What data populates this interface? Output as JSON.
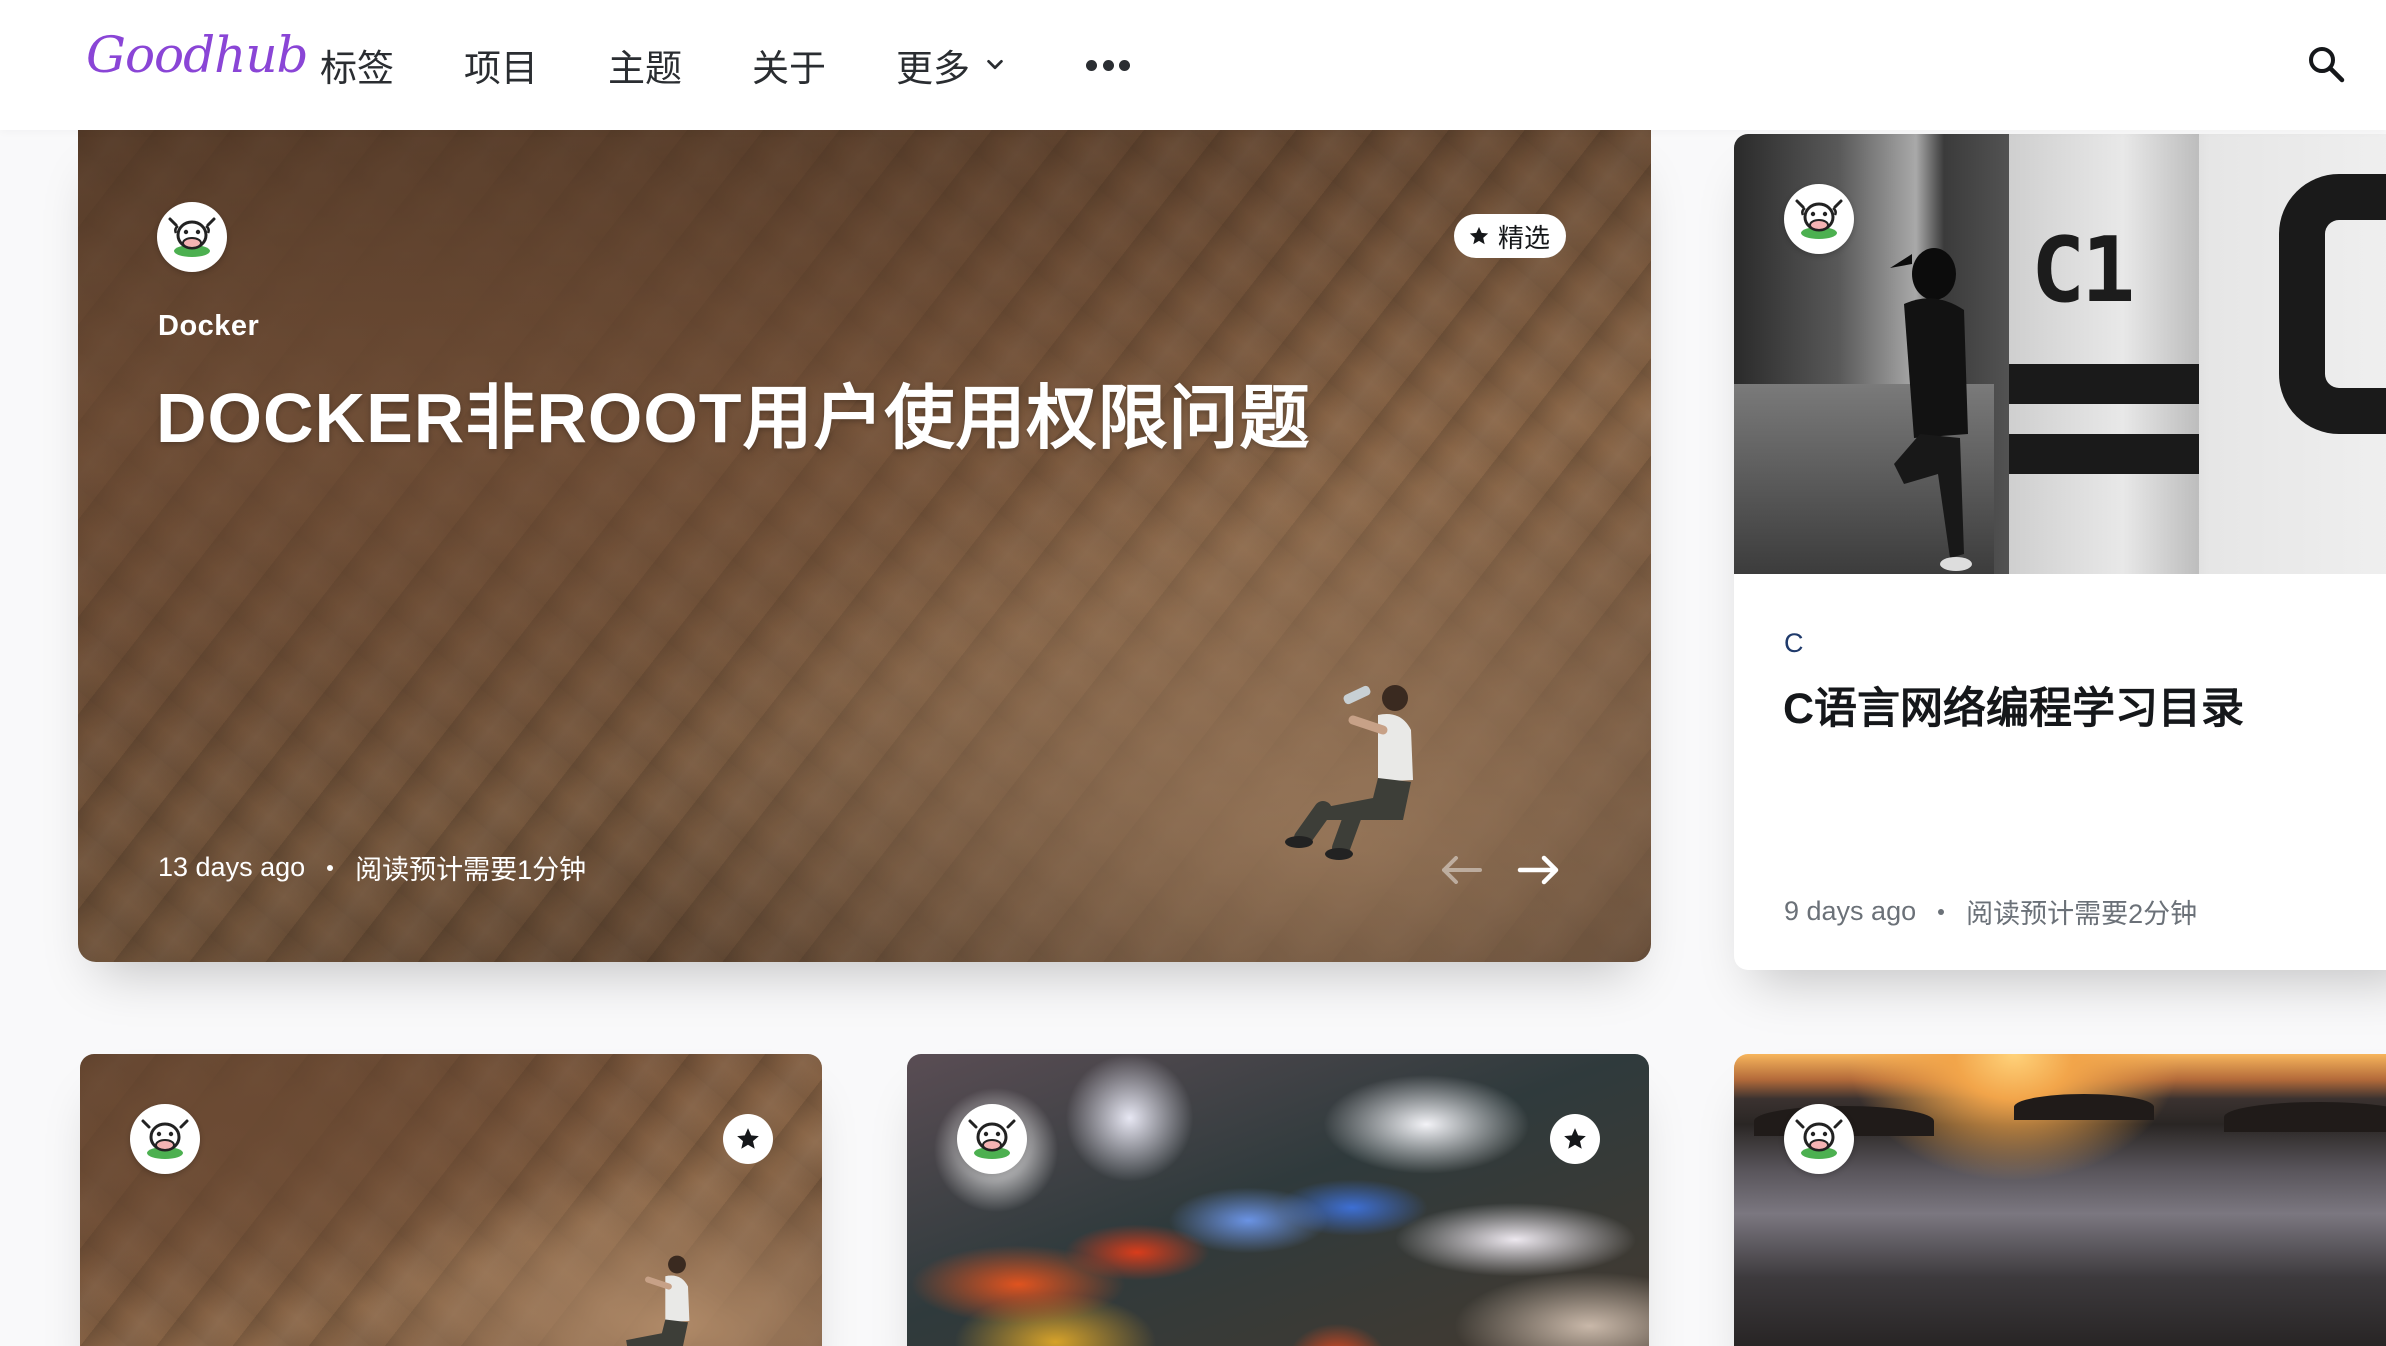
{
  "header": {
    "logo": "Goodhub",
    "nav": [
      {
        "label": "标签"
      },
      {
        "label": "项目"
      },
      {
        "label": "主题"
      },
      {
        "label": "关于"
      },
      {
        "label": "更多"
      }
    ]
  },
  "featured": {
    "tag": "Docker",
    "title": "DOCKER非ROOT用户使用权限问题",
    "badge": "精选",
    "date": "13 days ago",
    "reading_time": "阅读预计需要1分钟"
  },
  "side_post": {
    "tag": "C",
    "title": "C语言网络编程学习目录",
    "date": "9 days ago",
    "reading_time": "阅读预计需要2分钟",
    "sign_text": "C1"
  },
  "colors": {
    "logo": "#8a45d6",
    "tag_c": "#1f3a6b"
  },
  "icons": {
    "search": "search-icon",
    "chevron": "chevron-down-icon",
    "more": "more-icon",
    "star": "star-icon",
    "avatar": "cow-avatar-icon",
    "prev": "arrow-left-icon",
    "next": "arrow-right-icon"
  }
}
